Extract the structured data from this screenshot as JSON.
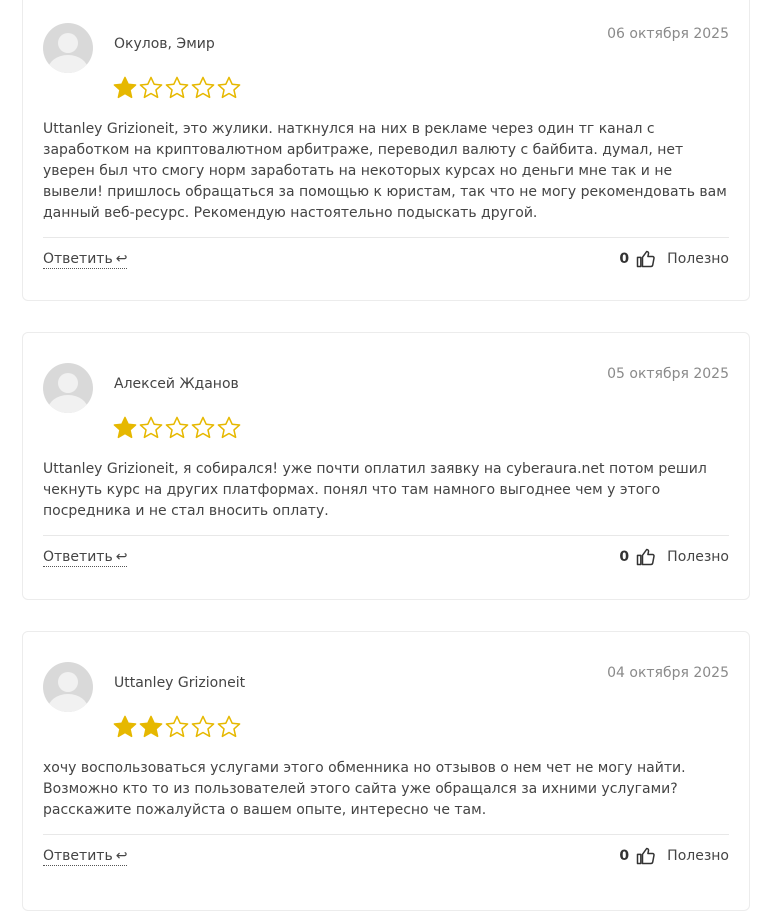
{
  "colors": {
    "star_filled": "#e6b800",
    "star_empty_stroke": "#e6b800"
  },
  "reviews": [
    {
      "author": "Окулов, Эмир",
      "date": "06 октября 2025",
      "rating": 1,
      "max_rating": 5,
      "text": "Uttanley Grizioneit, это жулики. наткнулся на них в рекламе через один тг канал с заработком на криптовалютном арбитраже, переводил валюту с байбита. думал, нет уверен был что смогу норм заработать на некоторых курсах но деньги мне так и не вывели! пришлось обращаться за помощью к юристам, так что не могу рекомендовать вам данный веб-ресурс. Рекомендую настоятельно подыскать другой.",
      "reply_label": "Ответить",
      "likes": "0",
      "useful_label": "Полезно"
    },
    {
      "author": "Алексей Жданов",
      "date": "05 октября 2025",
      "rating": 1,
      "max_rating": 5,
      "text": "Uttanley Grizioneit, я собирался! уже почти оплатил заявку на cyberaura.net потом решил чекнуть курс на других платформах. понял что там намного выгоднее чем у этого посредника и не стал вносить оплату.",
      "reply_label": "Ответить",
      "likes": "0",
      "useful_label": "Полезно"
    },
    {
      "author": "Uttanley Grizioneit",
      "date": "04 октября 2025",
      "rating": 2,
      "max_rating": 5,
      "text": "хочу воспользоваться услугами этого обменника но отзывов о нем чет не могу найти. Возможно кто то из пользователей этого сайта уже обращался за ихними услугами? расскажите пожалуйста о вашем опыте, интересно че там.",
      "reply_label": "Ответить",
      "likes": "0",
      "useful_label": "Полезно"
    }
  ]
}
